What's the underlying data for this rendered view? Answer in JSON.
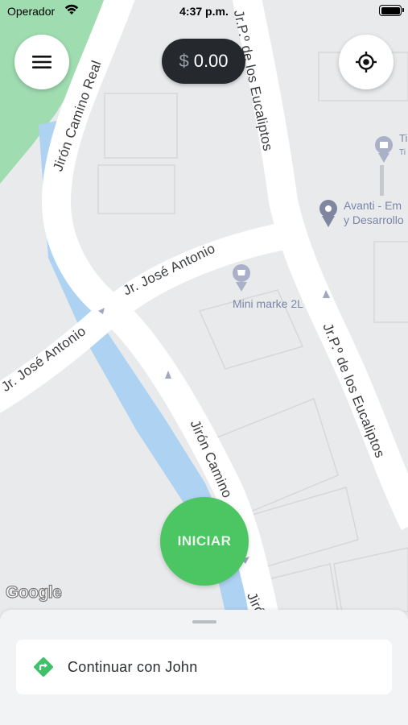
{
  "status_bar": {
    "carrier": "Operador",
    "time": "4:37 p.m."
  },
  "balance": {
    "currency": "$",
    "amount": "0.00"
  },
  "map": {
    "streets": [
      {
        "id": "camino-real",
        "name": "Jirón Camino Real"
      },
      {
        "id": "eucaliptos-top",
        "name": "Jr.P.º de los Eucaliptos"
      },
      {
        "id": "eucaliptos-bottom",
        "name": "Jr.P.º de los Eucaliptos"
      },
      {
        "id": "jose-antonio-right",
        "name": "Jr. José Antonio"
      },
      {
        "id": "jose-antonio-left",
        "name": "Jr. José Antonio"
      },
      {
        "id": "camino-lower",
        "name": "Jirón Camino"
      },
      {
        "id": "camino-bottom-edge",
        "name": "Jirón"
      }
    ],
    "pois": [
      {
        "id": "mini-market",
        "label": "Mini marke 2L"
      },
      {
        "id": "avanti",
        "label_line1": "Avanti - Em",
        "label_line2": "y Desarrollo"
      },
      {
        "id": "shop-right",
        "label_line1": "Ti",
        "label_line2": "Ti"
      }
    ],
    "attribution": "Google"
  },
  "start_button": {
    "label": "INICIAR"
  },
  "sheet": {
    "continue_label": "Continuar con John"
  },
  "colors": {
    "start_green": "#4cc663",
    "route_green": "#3ec16a",
    "pill_bg": "#25292d",
    "water": "#aed2f2",
    "park": "#9fdcb0"
  }
}
